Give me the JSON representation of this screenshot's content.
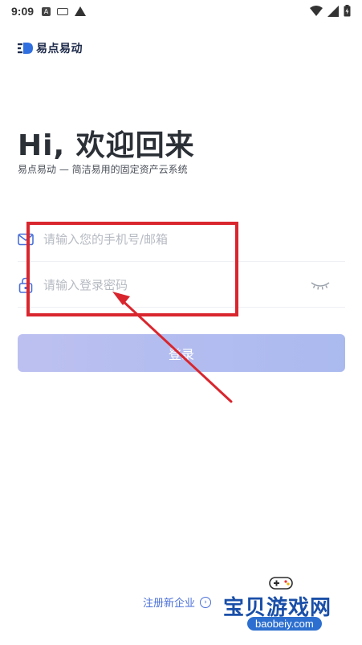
{
  "status_bar": {
    "time": "9:09"
  },
  "brand": {
    "logo_text": "易点易动"
  },
  "header": {
    "title": "Hi, 欢迎回来",
    "subtitle": "易点易动 — 简洁易用的固定资产云系统"
  },
  "form": {
    "phone_placeholder": "请输入您的手机号/邮箱",
    "phone_value": "",
    "password_placeholder": "请输入登录密码",
    "password_value": "",
    "login_label": "登录"
  },
  "footer": {
    "register_label": "注册新企业"
  },
  "watermark": {
    "text": "宝贝游戏网",
    "url": "baobeiy.com"
  },
  "colors": {
    "accent": "#a6b6ee",
    "annotation": "#d9262e",
    "link": "#4a6fd8"
  }
}
